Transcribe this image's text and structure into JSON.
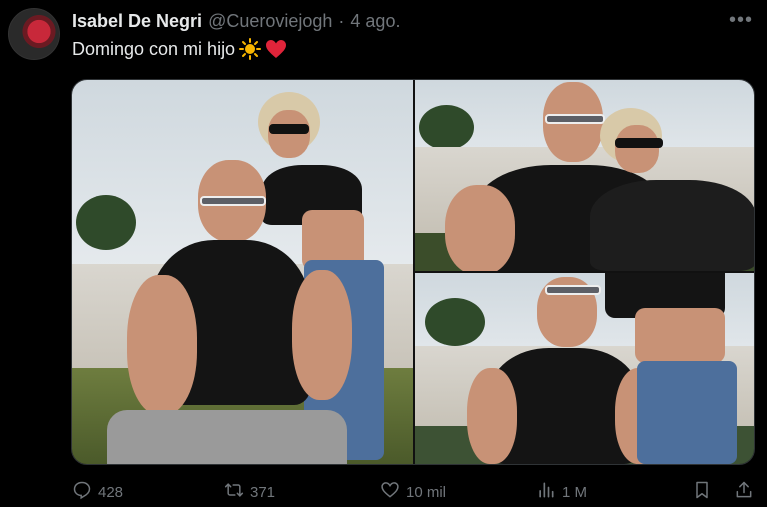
{
  "tweet": {
    "author_name": "Isabel De Negri",
    "handle": "@Cueroviejogh",
    "separator": "·",
    "date": "4 ago.",
    "more_label": "•••",
    "text": "Domingo con mi hijo",
    "emojis": [
      "sun-emoji",
      "red-heart-emoji"
    ]
  },
  "media": {
    "photo_count": 3
  },
  "actions": {
    "replies": "428",
    "retweets": "371",
    "likes": "10 mil",
    "views": "1 M"
  },
  "colors": {
    "background": "#000000",
    "text_primary": "#e7e9ea",
    "text_secondary": "#71767b",
    "heart": "#e0243a",
    "sun": "#f7b500"
  }
}
